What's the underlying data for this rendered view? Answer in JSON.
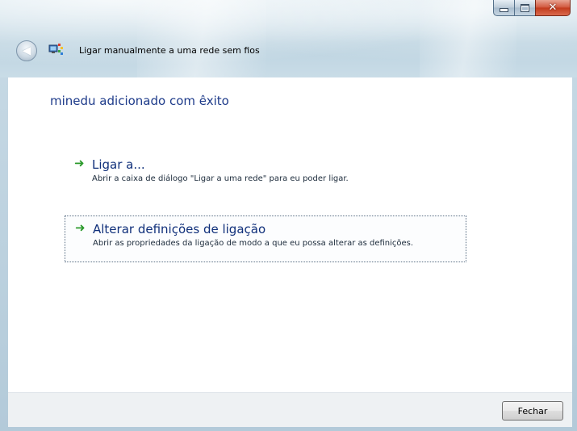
{
  "window": {
    "title": "Ligar manualmente a uma rede sem fios",
    "caption": {
      "minimize": "–",
      "maximize": "□",
      "close": "✕"
    }
  },
  "main": {
    "heading": "minedu adicionado com êxito",
    "commands": [
      {
        "title": "Ligar a...",
        "description": "Abrir a caixa de diálogo \"Ligar a uma rede\" para eu poder ligar."
      },
      {
        "title": "Alterar definições de ligação",
        "description": "Abrir as propriedades da ligação de modo a que eu possa alterar as definições."
      }
    ]
  },
  "footer": {
    "close_label": "Fechar"
  },
  "icons": {
    "back": "back-arrow-icon",
    "network": "wireless-network-icon",
    "command_arrow": "green-arrow-icon"
  },
  "colors": {
    "heading": "#1e3b8a",
    "command_title": "#0f2f7a",
    "arrow": "#2c9a2c",
    "close_button_red": "#c23a1c"
  }
}
